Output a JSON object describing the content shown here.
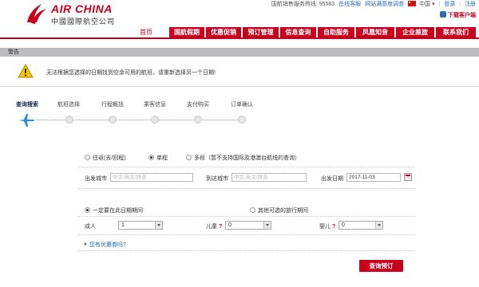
{
  "header": {
    "logo_en": "AIR CHINA",
    "logo_cn": "中國國際航空公司",
    "hotline": "国航销售服务热线: 95583",
    "online_service": "在线客服",
    "survey": "网站满意度调查",
    "language": "中国",
    "login": "登录",
    "register": "注册",
    "download_app": "下载客户端"
  },
  "nav": {
    "items": [
      "首页",
      "国航假期",
      "优惠促销",
      "预订管理",
      "信息查询",
      "自助服务",
      "凤凰知音",
      "企业差旅",
      "联系我们"
    ],
    "active": "首页"
  },
  "warning": {
    "bar_title": "警告",
    "message": "无法根据您选择的日期找到空余可用的航班，请重新选择另一个日期!"
  },
  "steps": {
    "items": [
      "查询搜索",
      "航班选择",
      "行程概括",
      "乘客信息",
      "支付购买",
      "订单确认"
    ],
    "current_index": 0
  },
  "form": {
    "trip_types": [
      "往返(去/回程)",
      "单程",
      "多段（暂不支持国际及港澳台航线的查询）"
    ],
    "trip_selected": "单程",
    "from_label": "出发城市",
    "from_placeholder": "中文/英文/拼音",
    "to_label": "到达城市",
    "to_placeholder": "中文/英文/拼音",
    "date_label": "出发日期",
    "date_value": "2017-11-03",
    "date_options": [
      "一定要在此日期期间",
      "其他可选的旅行期间"
    ],
    "date_option_selected": "一定要在此日期期间",
    "adult_label": "成人",
    "adult_value": "1",
    "child_label": "儿童",
    "child_value": "0",
    "infant_label": "婴儿",
    "infant_value": "0",
    "help_mark": "?",
    "coupon_link": "您有优惠券吗?",
    "search_button": "查询预订"
  },
  "colors": {
    "brand_red": "#c8001e",
    "link_blue": "#2a6bb5",
    "warning_bar": "#bdbdbd"
  }
}
